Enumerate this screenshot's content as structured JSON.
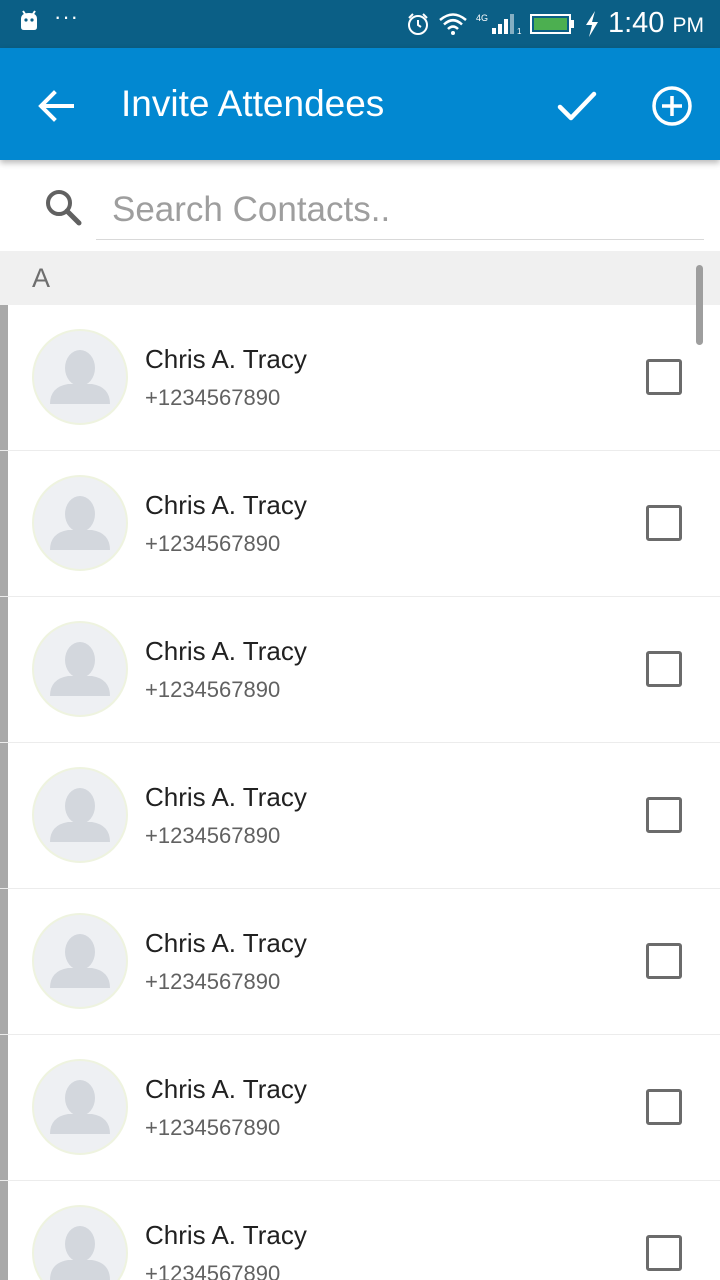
{
  "status_bar": {
    "dots": "···",
    "network": "4G",
    "sim": "1",
    "time": "1:40",
    "ampm": "PM",
    "icons": [
      "android-icon",
      "alarm-icon",
      "wifi-icon",
      "signal-icon",
      "battery-icon",
      "charging-icon"
    ]
  },
  "app_bar": {
    "title": "Invite Attendees",
    "color": "#0288d1",
    "status_color": "#0b5f86"
  },
  "search": {
    "placeholder": "Search Contacts..",
    "value": ""
  },
  "section": {
    "letter": "A"
  },
  "contacts": [
    {
      "name": "Chris A. Tracy",
      "phone": "+1234567890",
      "checked": false
    },
    {
      "name": "Chris A. Tracy",
      "phone": "+1234567890",
      "checked": false
    },
    {
      "name": "Chris A. Tracy",
      "phone": "+1234567890",
      "checked": false
    },
    {
      "name": "Chris A. Tracy",
      "phone": "+1234567890",
      "checked": false
    },
    {
      "name": "Chris A. Tracy",
      "phone": "+1234567890",
      "checked": false
    },
    {
      "name": "Chris A. Tracy",
      "phone": "+1234567890",
      "checked": false
    },
    {
      "name": "Chris A. Tracy",
      "phone": "+1234567890",
      "checked": false
    }
  ]
}
